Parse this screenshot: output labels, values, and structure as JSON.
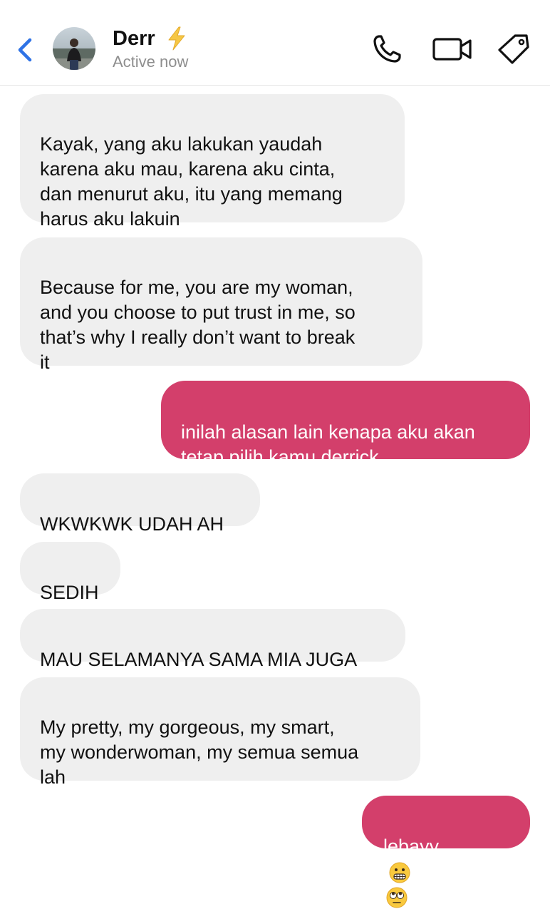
{
  "header": {
    "back_icon": "chevron-left-icon",
    "contact_name": "Derr",
    "name_emoji": "high-voltage-emoji",
    "status": "Active now",
    "call_icon": "phone-icon",
    "video_icon": "video-camera-icon",
    "tag_icon": "tag-icon",
    "accent_color": "#2f73e6"
  },
  "messages": [
    {
      "sender": "contact",
      "text": "Kayak, yang aku lakukan yaudah\nkarena aku mau, karena aku cinta,\ndan menurut aku, itu yang memang\nharus aku lakuin"
    },
    {
      "sender": "contact",
      "text": "Because for me, you are my woman,\nand you choose to put trust in me, so\nthat’s why I really don’t want to break\nit"
    },
    {
      "sender": "me",
      "text": "inilah alasan lain kenapa aku akan\ntetap pilih kamu derrick"
    },
    {
      "sender": "contact",
      "text": "WKWKWK UDAH AH"
    },
    {
      "sender": "contact",
      "text": "SEDIH"
    },
    {
      "sender": "contact",
      "text": "MAU SELAMANYA SAMA MIA JUGA"
    },
    {
      "sender": "contact",
      "text": "My pretty, my gorgeous, my smart,\nmy wonderwoman, my semua semua\nlah"
    },
    {
      "sender": "me",
      "text": "lebayy",
      "emojis": [
        "grimacing-face-emoji",
        "face-with-rolling-eyes-emoji"
      ]
    }
  ],
  "colors": {
    "incoming_bubble": "#efefef",
    "outgoing_bubble": "#d33f6b",
    "status_gray": "#8e8e8e"
  }
}
